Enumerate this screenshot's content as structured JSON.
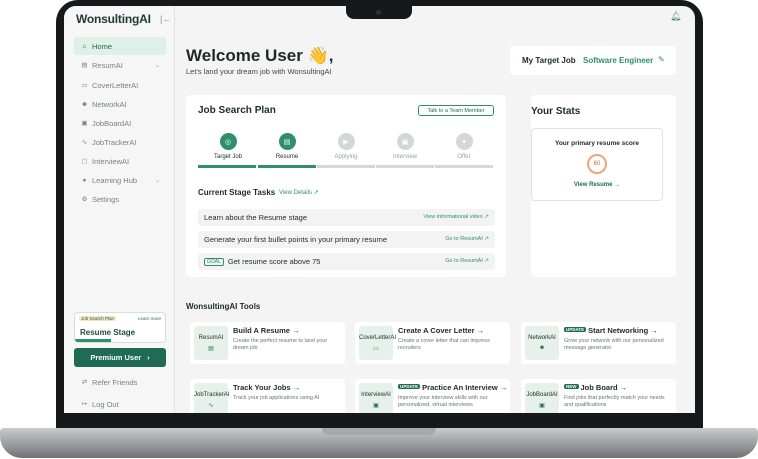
{
  "app": {
    "logo": "WonsultingAI",
    "collapse_icon": "collapse-icon"
  },
  "sidebar": {
    "items": [
      {
        "label": "Home",
        "icon": "home-icon",
        "active": true
      },
      {
        "label": "ResumAI",
        "icon": "document-icon",
        "has_chevron": true
      },
      {
        "label": "CoverLetterAI",
        "icon": "letter-icon"
      },
      {
        "label": "NetworkAI",
        "icon": "people-icon"
      },
      {
        "label": "JobBoardAI",
        "icon": "briefcase-icon"
      },
      {
        "label": "JobTrackerAI",
        "icon": "tracker-icon"
      },
      {
        "label": "InterviewAI",
        "icon": "chat-icon"
      },
      {
        "label": "Learning Hub",
        "icon": "bulb-icon",
        "has_chevron": true
      },
      {
        "label": "Settings",
        "icon": "gear-icon"
      }
    ],
    "promo": {
      "tag": "Job Search Plan",
      "link": "Learn more",
      "title": "Resume Stage",
      "progress": 0.4
    },
    "premium_label": "Premium User",
    "premium_chevron": "›",
    "bottom_items": [
      {
        "label": "Refer Friends",
        "icon": "refer-icon"
      },
      {
        "label": "Log Out",
        "icon": "logout-icon"
      }
    ]
  },
  "header": {
    "welcome": "Welcome User 👋,",
    "subtitle": "Let's land your dream job with WonsultingAI",
    "target_label": "My Target Job",
    "target_value": "Software Engineer",
    "notification_icon": "bell-icon"
  },
  "plan": {
    "title": "Job Search Plan",
    "talk_button": "Talk to a Team Member",
    "steps": [
      {
        "label": "Target Job",
        "state": "done",
        "icon": "target-icon"
      },
      {
        "label": "Resume",
        "state": "current",
        "icon": "document-icon"
      },
      {
        "label": "Applying",
        "state": "upcoming",
        "icon": "send-icon"
      },
      {
        "label": "Interview",
        "state": "upcoming",
        "icon": "chat-icon"
      },
      {
        "label": "Offer",
        "state": "upcoming",
        "icon": "trophy-icon"
      }
    ],
    "current_tasks_label": "Current Stage Tasks",
    "view_details": "View Details ↗",
    "tasks": [
      {
        "text": "Learn about the Resume stage",
        "link": "View informational video ↗"
      },
      {
        "text": "Generate your first bullet points in your primary resume",
        "link": "Go to ResumAI ↗"
      },
      {
        "text": "Get resume score above 75",
        "link": "Go to ResumAI ↗",
        "tag": "GOAL"
      }
    ]
  },
  "stats": {
    "title": "Your Stats",
    "score_title": "Your primary resume score",
    "score": "60",
    "view_resume": "View Resume →"
  },
  "tools": {
    "title": "WonsultingAI Tools",
    "items": [
      {
        "logo": "ResumAI",
        "name": "Build A Resume →",
        "desc": "Create the perfect resume to land your dream job",
        "badge": ""
      },
      {
        "logo": "CoverLetterAI",
        "name": "Create A Cover Letter →",
        "desc": "Create a cover letter that can impress recruiters",
        "badge": ""
      },
      {
        "logo": "NetworkAI",
        "name": "Start Networking →",
        "desc": "Grow your network with our personalized message generator",
        "badge": "UPDATE"
      },
      {
        "logo": "JobTrackerAI",
        "name": "Track Your Jobs →",
        "desc": "Track your job applications using AI",
        "badge": ""
      },
      {
        "logo": "InterviewAI",
        "name": "Practice An Interview →",
        "desc": "Improve your interview skills with our personalized, virtual interviews",
        "badge": "UPDATE"
      },
      {
        "logo": "JobBoardAI",
        "name": "Job Board →",
        "desc": "Find jobs that perfectly match your needs and qualifications",
        "badge": "NEW"
      }
    ]
  },
  "colors": {
    "accent": "#2f8f6a",
    "accent_dark": "#1f6b55",
    "sidebar_active": "#dff0e8",
    "score_ring": "#f0a27a"
  }
}
